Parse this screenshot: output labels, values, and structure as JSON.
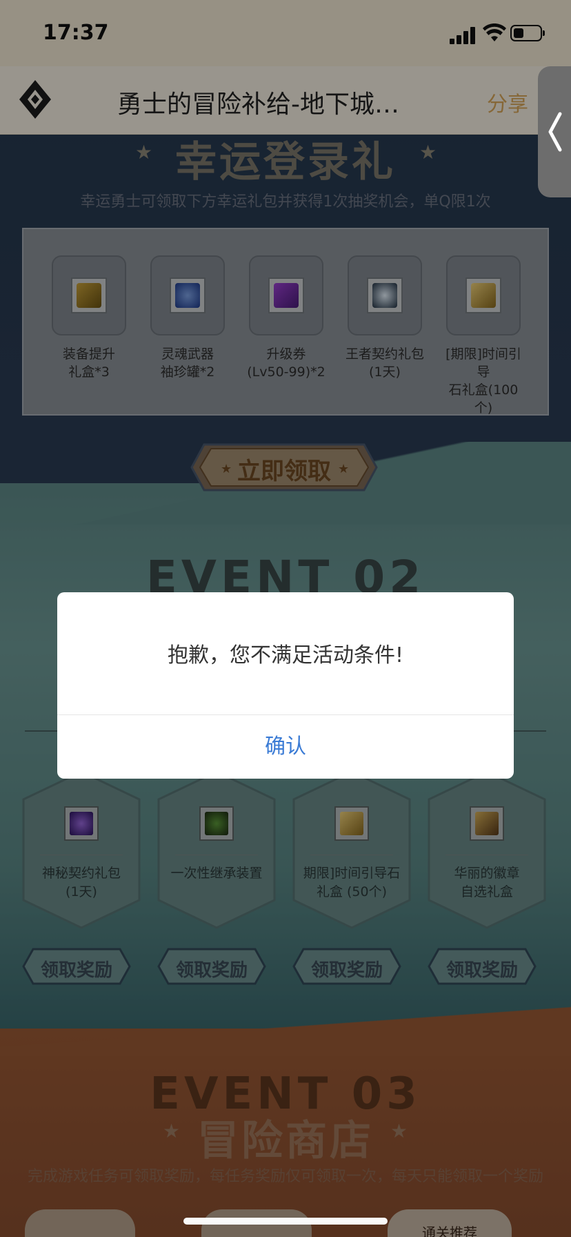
{
  "status_bar": {
    "time": "17:37"
  },
  "nav": {
    "title": "勇士的冒险补给-地下城…",
    "share": "分享"
  },
  "section1": {
    "title": "幸运登录礼",
    "subtitle": "幸运勇士可领取下方幸运礼包并获得1次抽奖机会，单Q限1次",
    "items": [
      {
        "line1": "装备提升",
        "line2": "礼盒*3"
      },
      {
        "line1": "灵魂武器",
        "line2": "袖珍罐*2"
      },
      {
        "line1": "升级券",
        "line2": "(Lv50-99)*2"
      },
      {
        "line1": "王者契约礼包",
        "line2": "(1天)"
      },
      {
        "line1": "[期限]时间引导",
        "line2": "石礼盒(100个)"
      }
    ],
    "claim_button": "立即领取"
  },
  "section2": {
    "bg_title": "EVENT 02",
    "rewards": [
      {
        "line1": "神秘契约礼包",
        "line2": "(1天)"
      },
      {
        "line1": "一次性继承装置",
        "line2": ""
      },
      {
        "line1": "期限]时间引导石",
        "line2": "礼盒 (50个)"
      },
      {
        "line1": "华丽的徽章",
        "line2": "自选礼盒"
      }
    ],
    "reward_button": "领取奖励"
  },
  "section3": {
    "bg_title": "EVENT 03",
    "title": "冒险商店",
    "subtitle": "完成游戏任务可领取奖励，每任务奖励仅可领取一次，每天只能领取一个奖励",
    "tab_label": "通关推荐"
  },
  "dialog": {
    "message": "抱歉，您不满足活动条件!",
    "confirm": "确认"
  },
  "colors": {
    "confirm_text": "#3a7bd5",
    "share_text": "#d9a75a",
    "overlay": "rgba(0,0,0,0.38)"
  }
}
